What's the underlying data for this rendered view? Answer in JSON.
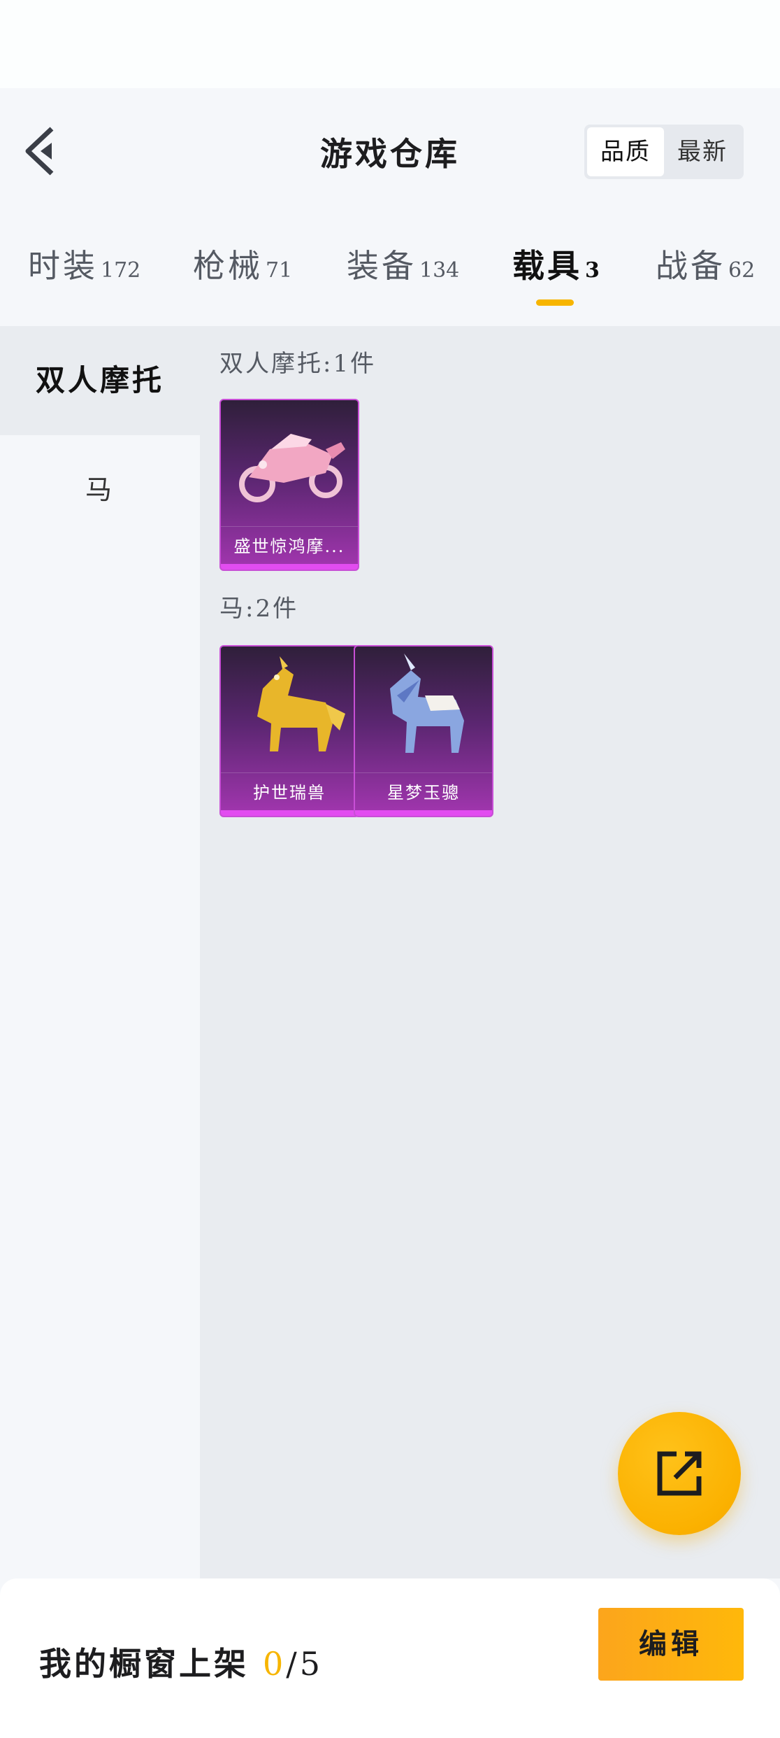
{
  "header": {
    "title": "游戏仓库",
    "sort_options": [
      "品质",
      "最新"
    ],
    "active_sort": "品质"
  },
  "tabs": [
    {
      "label": "时装",
      "count": "172"
    },
    {
      "label": "枪械",
      "count": "71"
    },
    {
      "label": "装备",
      "count": "134"
    },
    {
      "label": "载具",
      "count": "3"
    },
    {
      "label": "战备",
      "count": "62"
    }
  ],
  "active_tab": "载具",
  "sidebar": {
    "items": [
      {
        "label": "双人摩托"
      },
      {
        "label": "马"
      }
    ],
    "active": "双人摩托"
  },
  "groups": [
    {
      "title": "双人摩托:1件",
      "items": [
        {
          "name": "盛世惊鸿摩...",
          "icon": "motorcycle-image"
        }
      ]
    },
    {
      "title": "马:2件",
      "items": [
        {
          "name": "护世瑞兽",
          "icon": "golden-beast-image"
        },
        {
          "name": "星梦玉骢",
          "icon": "unicorn-horse-image"
        }
      ]
    }
  ],
  "bottom_bar": {
    "label": "我的橱窗上架",
    "count": "0",
    "total": "/5",
    "edit_label": "编辑"
  },
  "colors": {
    "accent": "#f7b500",
    "card_gradient_top": "#2f1f3a",
    "card_gradient_bottom": "#a336b0",
    "background": "#f5f7fa",
    "content_bg": "#e9ecf0"
  }
}
